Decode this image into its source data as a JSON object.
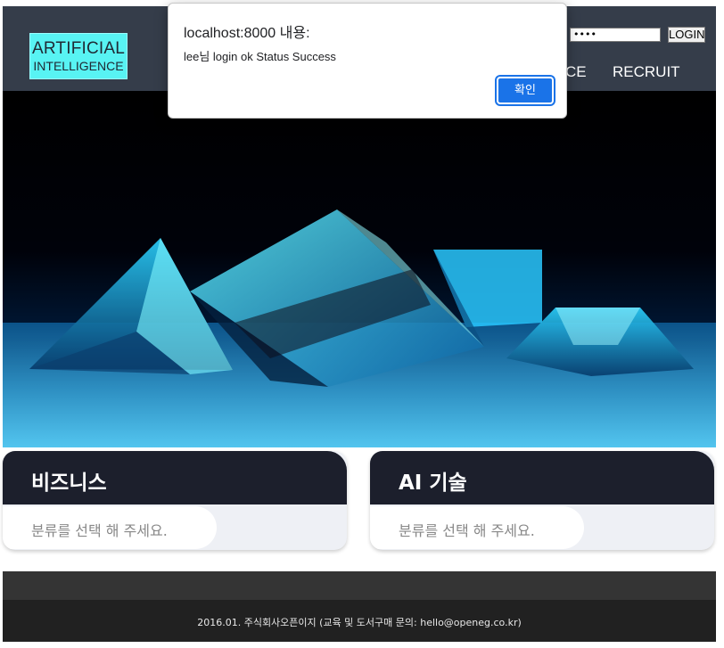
{
  "header": {
    "logo_line1": "ARTIFICIAL",
    "logo_line2": "INTELLIGENCE",
    "password_mask": "••••",
    "login_label": "LOGIN",
    "nav_items": [
      "CE",
      "RECRUIT"
    ]
  },
  "cards": [
    {
      "title": "비즈니스",
      "subtitle": "분류를 선택 해 주세요."
    },
    {
      "title": "AI 기술",
      "subtitle": "분류를 선택 해 주세요."
    }
  ],
  "footer": {
    "text": "2016.01. 주식회사오픈이지 (교육 및 도서구매 문의: hello@openeg.co.kr)"
  },
  "dialog": {
    "title": "localhost:8000 내용:",
    "message": "lee님 login ok Status Success",
    "ok_label": "확인"
  },
  "colors": {
    "header_bg": "#353d4a",
    "logo_bg": "#58f3f3",
    "card_header_bg": "#1c1f2c",
    "dialog_button": "#1a73e8",
    "footer_bg": "#212121"
  }
}
